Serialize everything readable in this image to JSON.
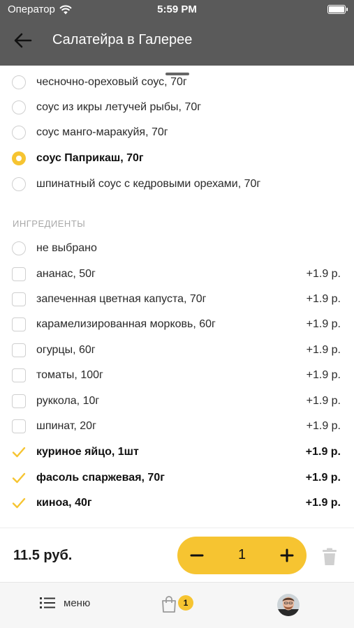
{
  "status_bar": {
    "carrier": "Оператор",
    "time": "5:59 PM"
  },
  "header": {
    "title": "Салатейра в Галерее"
  },
  "sauces": [
    {
      "label": "чесночно-ореховый соус, 70г",
      "selected": false
    },
    {
      "label": "соус из икры летучей рыбы, 70г",
      "selected": false
    },
    {
      "label": "соус манго-маракуйя, 70г",
      "selected": false
    },
    {
      "label": "соус Паприкаш, 70г",
      "selected": true
    },
    {
      "label": "шпинатный соус с кедровыми орехами, 70г",
      "selected": false
    }
  ],
  "ingredients_section": {
    "title": "ИНГРЕДИЕНТЫ",
    "none_option": "не выбрано",
    "items": [
      {
        "label": "ананас, 50г",
        "price": "+1.9 р.",
        "checked": false
      },
      {
        "label": "запеченная цветная капуста, 70г",
        "price": "+1.9 р.",
        "checked": false
      },
      {
        "label": "карамелизированная морковь, 60г",
        "price": "+1.9 р.",
        "checked": false
      },
      {
        "label": "огурцы, 60г",
        "price": "+1.9 р.",
        "checked": false
      },
      {
        "label": "томаты, 100г",
        "price": "+1.9 р.",
        "checked": false
      },
      {
        "label": "руккола, 10г",
        "price": "+1.9 р.",
        "checked": false
      },
      {
        "label": "шпинат, 20г",
        "price": "+1.9 р.",
        "checked": false
      },
      {
        "label": "куриное яйцо, 1шт",
        "price": "+1.9 р.",
        "checked": true
      },
      {
        "label": "фасоль спаржевая, 70г",
        "price": "+1.9 р.",
        "checked": true
      },
      {
        "label": "киноа, 40г",
        "price": "+1.9 р.",
        "checked": true
      }
    ]
  },
  "order": {
    "total": "11.5 руб.",
    "quantity": "1"
  },
  "tabbar": {
    "menu_label": "меню",
    "cart_count": "1"
  },
  "colors": {
    "accent": "#f6c431",
    "header_bg": "#5a5a5a"
  }
}
